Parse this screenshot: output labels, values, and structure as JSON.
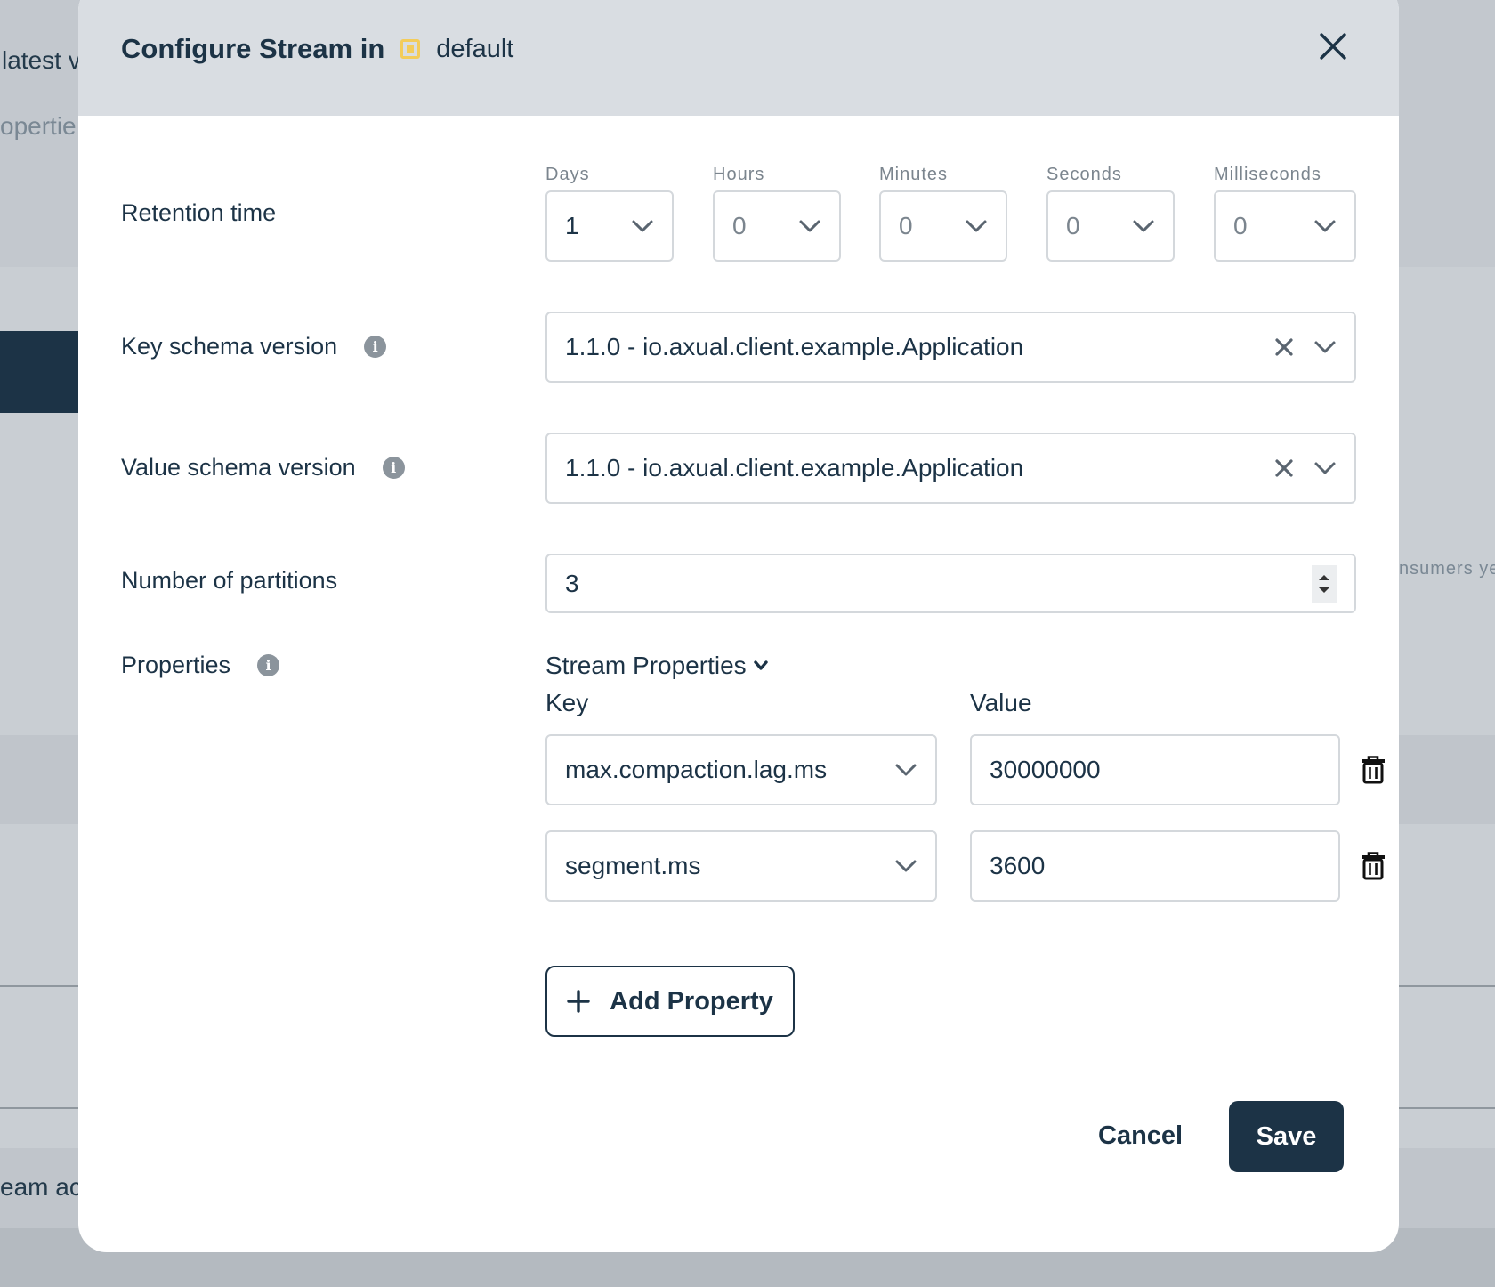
{
  "background": {
    "fragment_1": "latest v",
    "fragment_2": "opertie",
    "fragment_3": "nsumers ye",
    "fragment_4": "eam ac"
  },
  "modal": {
    "title": "Configure Stream in",
    "environment": "default"
  },
  "retention": {
    "label": "Retention time",
    "fields": [
      {
        "label": "Days",
        "value": "1"
      },
      {
        "label": "Hours",
        "value": "0"
      },
      {
        "label": "Minutes",
        "value": "0"
      },
      {
        "label": "Seconds",
        "value": "0"
      },
      {
        "label": "Milliseconds",
        "value": "0"
      }
    ]
  },
  "key_schema": {
    "label": "Key schema version",
    "value": "1.1.0 - io.axual.client.example.Application"
  },
  "value_schema": {
    "label": "Value schema version",
    "value": "1.1.0 - io.axual.client.example.Application"
  },
  "partitions": {
    "label": "Number of partitions",
    "value": "3"
  },
  "properties": {
    "label": "Properties",
    "toggle": "Stream Properties",
    "key_header": "Key",
    "value_header": "Value",
    "rows": [
      {
        "key": "max.compaction.lag.ms",
        "value": "30000000"
      },
      {
        "key": "segment.ms",
        "value": "3600"
      }
    ],
    "add_label": "Add Property"
  },
  "actions": {
    "cancel": "Cancel",
    "save": "Save"
  },
  "colors": {
    "primary": "#1c3346",
    "env_badge": "#f3cc5a"
  }
}
